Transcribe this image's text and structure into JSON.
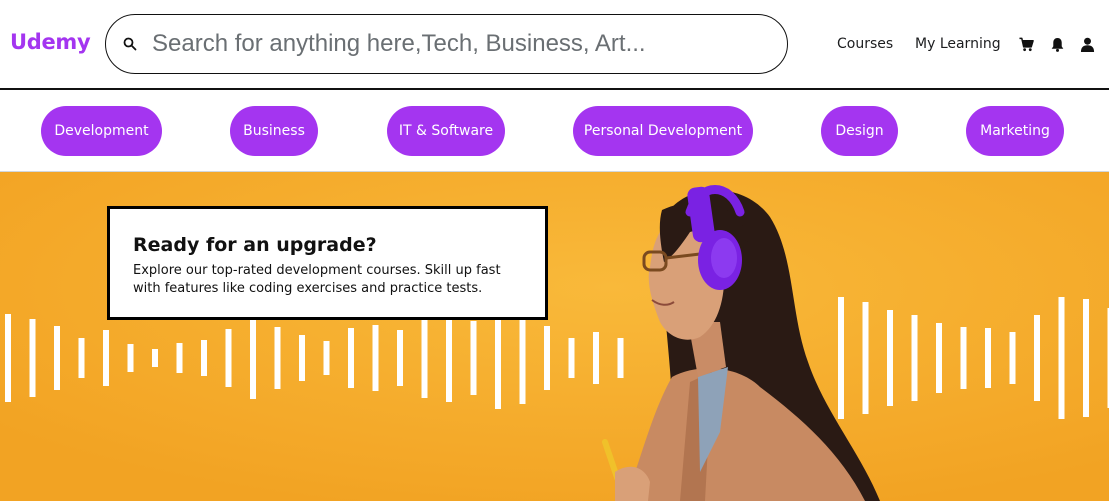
{
  "brand": {
    "name": "Udemy",
    "color": "#a435f0"
  },
  "search": {
    "placeholder": "Search for anything here,Tech, Business, Art...",
    "value": "",
    "icon": "search-icon"
  },
  "nav": {
    "courses": "Courses",
    "my_learning": "My Learning",
    "icons": [
      "cart-icon",
      "bell-icon",
      "user-icon"
    ]
  },
  "categories": [
    "Development",
    "Business",
    "IT & Software",
    "Personal Development",
    "Design",
    "Marketing"
  ],
  "hero": {
    "title": "Ready for an upgrade?",
    "description": "Explore our top-rated development courses. Skill up fast with features like coding exercises and practice tests.",
    "background_color": "#f5ab2c",
    "accent_color": "#7a22e3"
  }
}
